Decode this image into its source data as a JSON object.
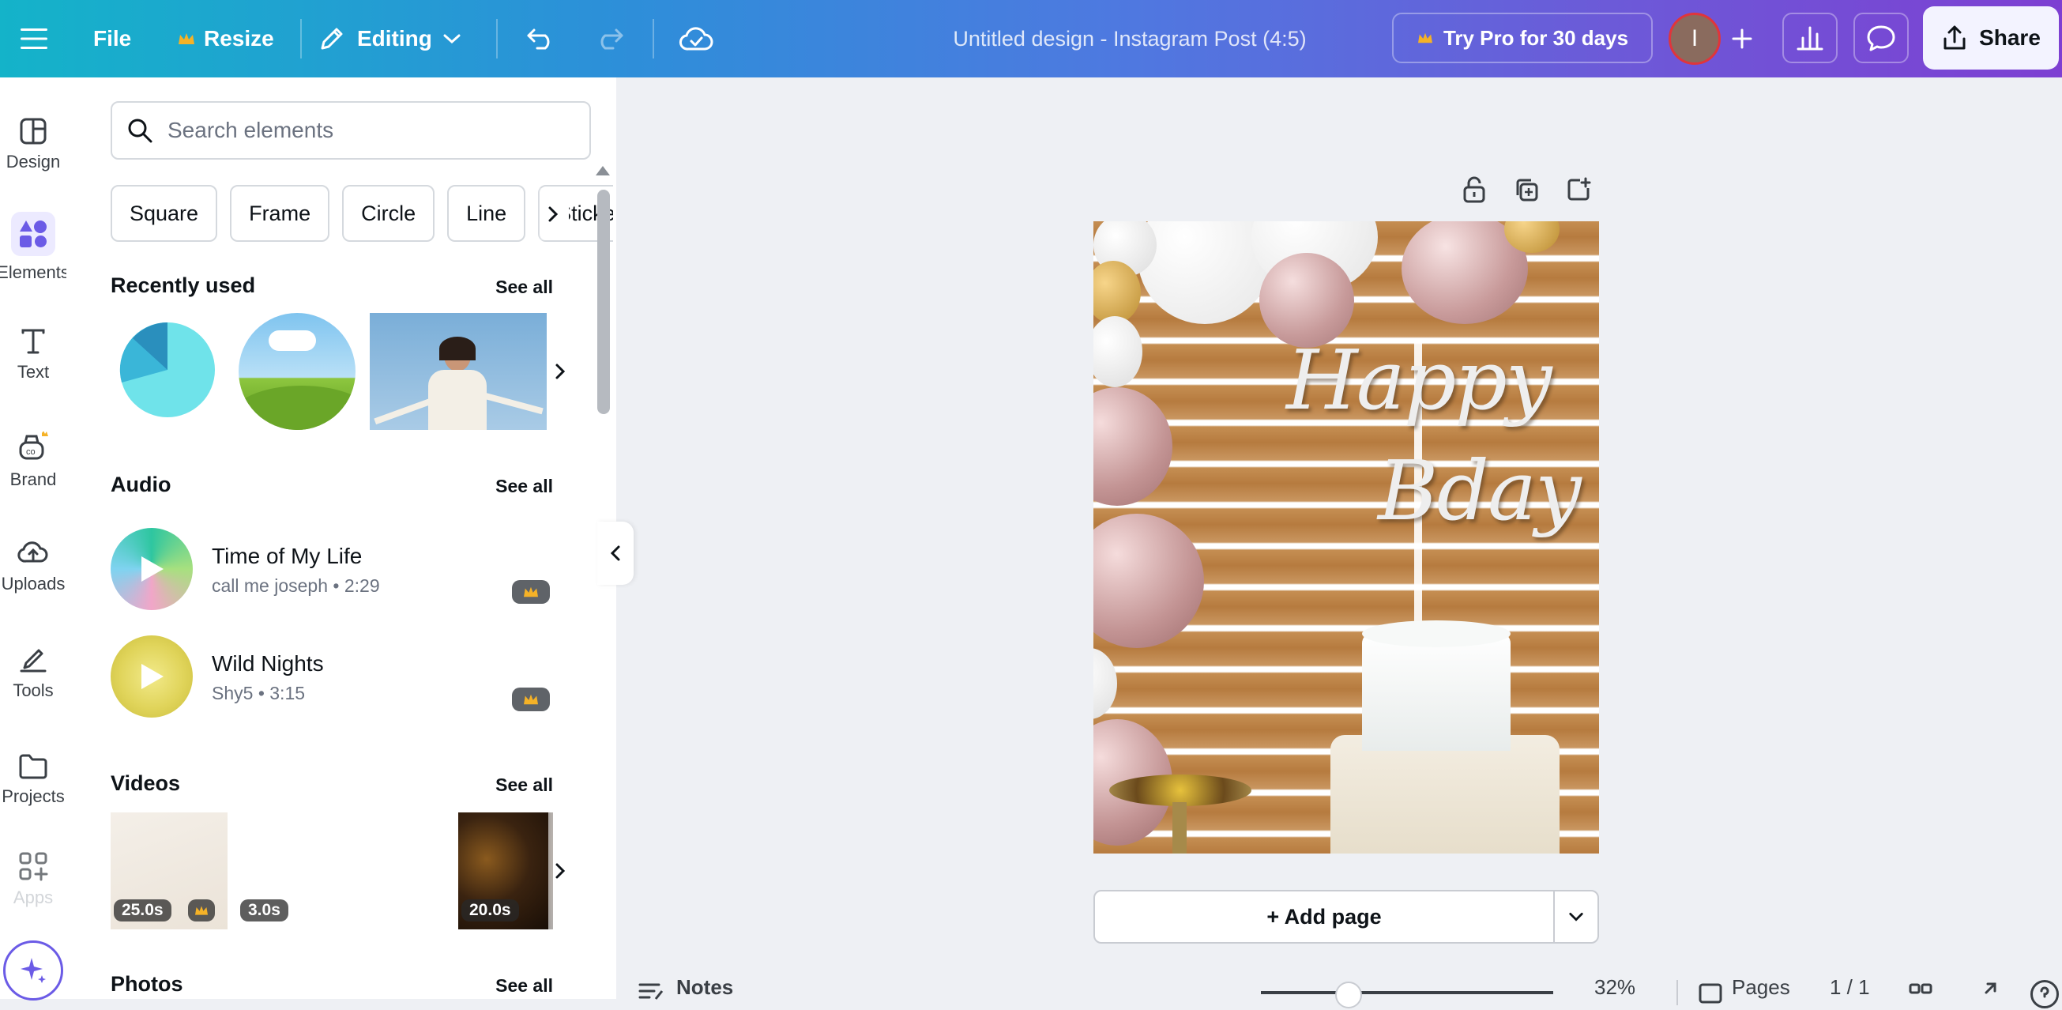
{
  "topbar": {
    "file_label": "File",
    "resize_label": "Resize",
    "editing_label": "Editing",
    "doc_title": "Untitled design - Instagram Post (4:5)",
    "pro_label": "Try Pro for 30 days",
    "avatar_initial": "I",
    "share_label": "Share"
  },
  "rail": {
    "items": [
      {
        "label": "Design"
      },
      {
        "label": "Elements"
      },
      {
        "label": "Text"
      },
      {
        "label": "Brand"
      },
      {
        "label": "Uploads"
      },
      {
        "label": "Tools"
      },
      {
        "label": "Projects"
      },
      {
        "label": "Apps"
      }
    ]
  },
  "panel": {
    "search_placeholder": "Search elements",
    "chips": [
      "Square",
      "Frame",
      "Circle",
      "Line",
      "Sticker"
    ],
    "recently_used": {
      "title": "Recently used",
      "see_all": "See all"
    },
    "audio": {
      "title": "Audio",
      "see_all": "See all",
      "tracks": [
        {
          "title": "Time of My Life",
          "subtitle": "call me joseph • 2:29"
        },
        {
          "title": "Wild Nights",
          "subtitle": "Shy5 • 3:15"
        }
      ]
    },
    "videos": {
      "title": "Videos",
      "see_all": "See all",
      "items": [
        {
          "duration": "25.0s"
        },
        {
          "duration": "3.0s"
        },
        {
          "duration": "20.0s"
        }
      ]
    },
    "photos": {
      "title": "Photos",
      "see_all": "See all"
    }
  },
  "canvas": {
    "add_page_label": "+ Add page",
    "design_text_line1": "Happy",
    "design_text_line2": "Bday"
  },
  "footer": {
    "notes_label": "Notes",
    "zoom_label": "32%",
    "pages_label": "Pages",
    "page_count": "1 / 1"
  },
  "colors": {
    "accent": "#6b5be6",
    "crown": "#f5b227",
    "avatar_ring": "#e0353b"
  }
}
